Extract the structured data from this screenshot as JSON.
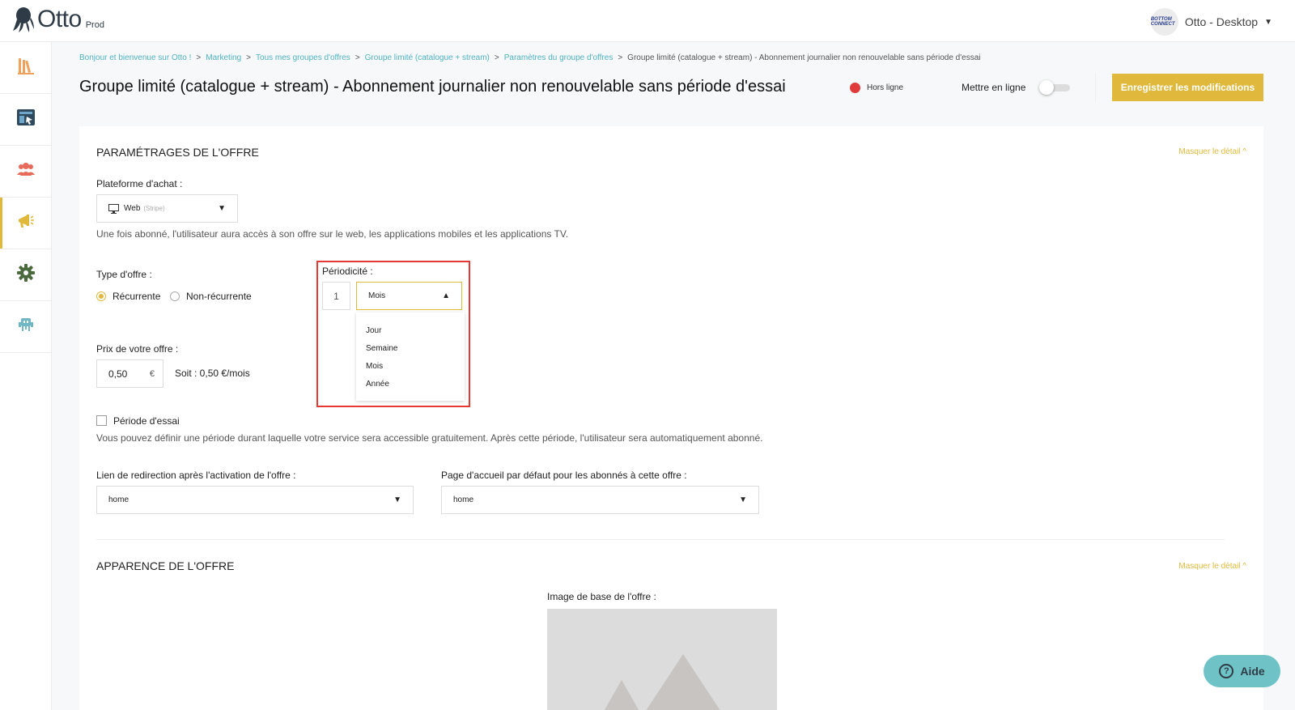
{
  "app": {
    "name": "Otto",
    "env": "Prod"
  },
  "account": {
    "avatar_text": "BOTTOM CONNECT",
    "name": "Otto - Desktop"
  },
  "sidebar": {
    "items": [
      {
        "icon": "library-icon"
      },
      {
        "icon": "catalog-icon"
      },
      {
        "icon": "users-icon"
      },
      {
        "icon": "megaphone-icon",
        "active": true
      },
      {
        "icon": "gear-icon"
      },
      {
        "icon": "space-invader-icon"
      }
    ]
  },
  "breadcrumb": {
    "items": [
      "Bonjour et bienvenue sur Otto !",
      "Marketing",
      "Tous mes groupes d'offres",
      "Groupe limité (catalogue + stream)",
      "Paramètres du groupe d'offres"
    ],
    "current": "Groupe limité (catalogue + stream) - Abonnement journalier non renouvelable sans période d'essai",
    "separator": ">"
  },
  "header": {
    "title": "Groupe limité (catalogue + stream) - Abonnement journalier non renouvelable sans période d'essai",
    "status": "Hors ligne",
    "online_label": "Mettre en ligne",
    "save_label": "Enregistrer les modifications"
  },
  "settings": {
    "title": "PARAMÉTRAGES DE L'OFFRE",
    "hide_label": "Masquer le détail ^",
    "platform_label": "Plateforme d'achat :",
    "platform_value": "Web",
    "platform_sub": "(Stripe)",
    "platform_help": "Une fois abonné, l'utilisateur aura accès à son offre sur le web, les applications mobiles et les applications TV.",
    "type_label": "Type d'offre :",
    "type_options": [
      "Récurrente",
      "Non-récurrente"
    ],
    "period_label": "Périodicité :",
    "period_count": "1",
    "period_value": "Mois",
    "period_options": [
      "Jour",
      "Semaine",
      "Mois",
      "Année"
    ],
    "price_label": "Prix de votre offre :",
    "price_value": "0,50",
    "currency": "€",
    "price_summary": "Soit : 0,50 €/mois",
    "trial_label": "Période d'essai",
    "trial_help": "Vous pouvez définir une période durant laquelle votre service sera accessible gratuitement. Après cette période, l'utilisateur sera automatiquement abonné.",
    "redirect_label": "Lien de redirection après l'activation de l'offre :",
    "redirect_value": "home",
    "home_label": "Page d'accueil par défaut pour les abonnés à cette offre :",
    "home_value": "home"
  },
  "appearance": {
    "title": "APPARENCE DE L'OFFRE",
    "hide_label": "Masquer le détail ^",
    "image_label": "Image de base de l'offre :"
  },
  "help_button": {
    "label": "Aide"
  },
  "colors": {
    "accent": "#e0b93c",
    "link": "#4fb3c1",
    "offline": "#e03b3b",
    "highlight": "#e53935"
  }
}
